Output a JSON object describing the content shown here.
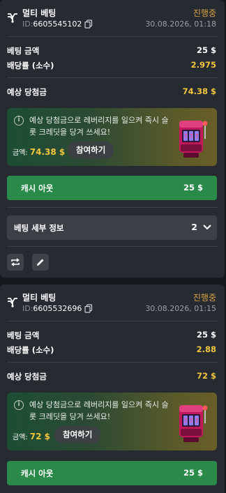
{
  "bets": [
    {
      "title": "멀티 베팅",
      "id_label": "ID:",
      "id": "6605545102",
      "status": "진행중",
      "date": "30.08.2026, 01:18",
      "stake_label": "베팅 금액",
      "stake": "25 $",
      "odds_label": "배당률 (소수)",
      "odds": "2.975",
      "potential_label": "예상 당첨금",
      "potential": "74.38 $",
      "promo_text": "예상 당첨금으로 레버리지를 일으켜 즉시 슬롯 크레딧을 당겨 쓰세요!",
      "promo_amount_label": "금액:",
      "promo_amount": "74.38 $",
      "join_label": "참여하기",
      "cashout_label": "캐시 아웃",
      "cashout_amount": "25 $",
      "details_label": "베팅 세부 정보",
      "details_count": "2"
    },
    {
      "title": "멀티 베팅",
      "id_label": "ID:",
      "id": "6605532696",
      "status": "진행중",
      "date": "30.08.2026, 01:15",
      "stake_label": "베팅 금액",
      "stake": "25 $",
      "odds_label": "배당률 (소수)",
      "odds": "2.88",
      "potential_label": "예상 당첨금",
      "potential": "72 $",
      "promo_text": "예상 당첨금으로 레버리지를 일으켜 즉시 슬롯 크레딧을 당겨 쓰세요!",
      "promo_amount_label": "금액:",
      "promo_amount": "72 $",
      "join_label": "참여하기",
      "cashout_label": "캐시 아웃",
      "cashout_amount": "25 $"
    }
  ],
  "icons": {
    "bet_type": "multi-bet-icon",
    "copy": "copy-icon",
    "info": "info-icon",
    "slot": "slot-machine-icon",
    "chevron": "chevron-down-icon",
    "repeat": "repeat-icon",
    "edit": "edit-pencil-icon"
  },
  "colors": {
    "status": "#d9a441",
    "highlight": "#f2c53d",
    "cashout": "#2a8a4a"
  }
}
